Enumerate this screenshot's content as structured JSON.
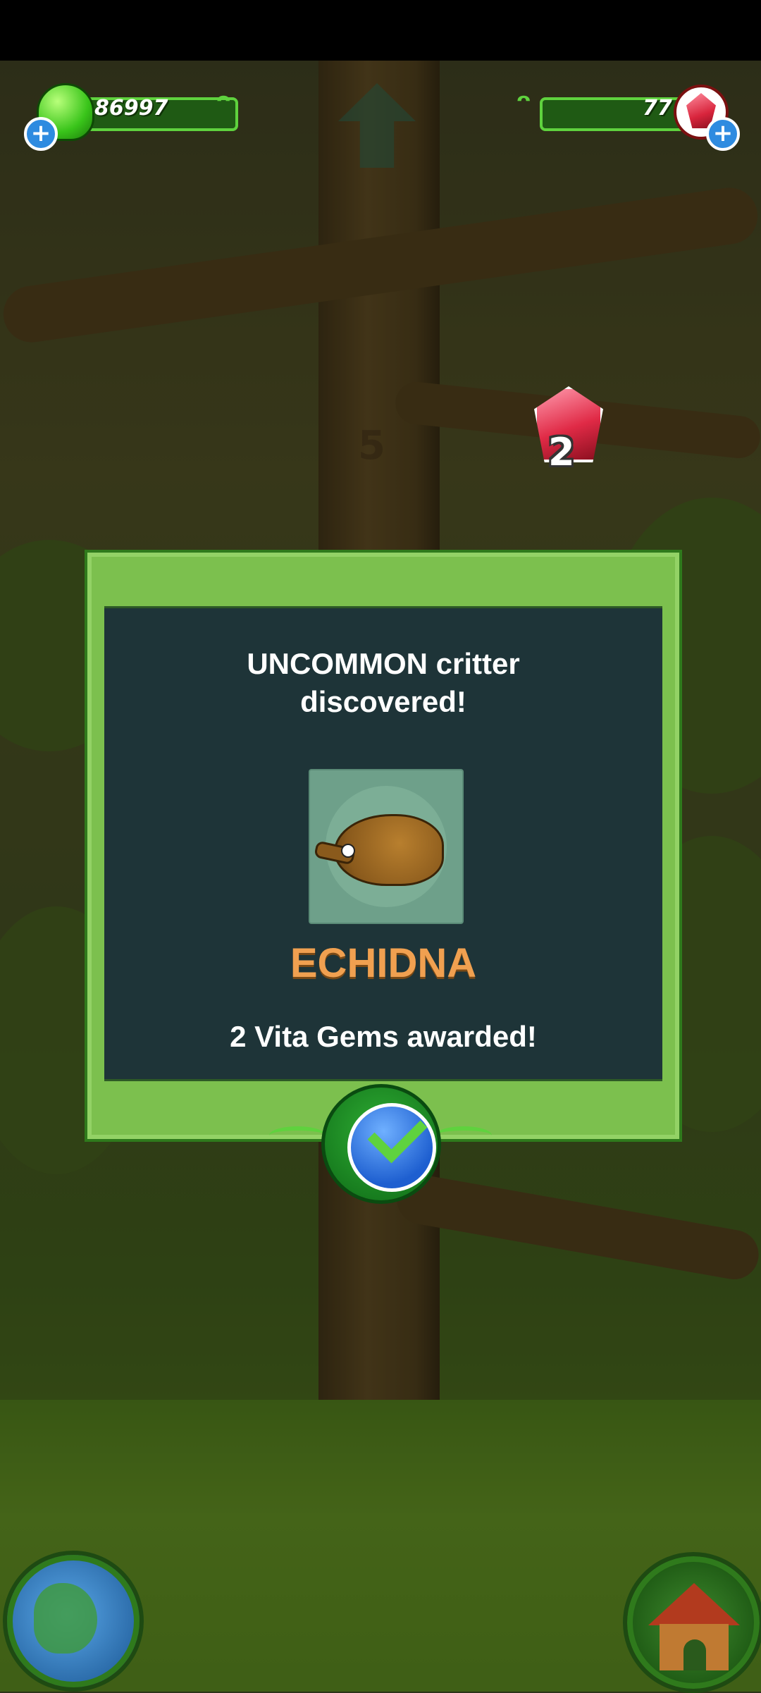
{
  "hud": {
    "jelly_count": "86997",
    "gem_count": "77",
    "add_jelly_label": "+",
    "add_gem_label": "+"
  },
  "scene": {
    "tree_floor_number": "5",
    "floating_reward_gems": "2"
  },
  "dialog": {
    "title": "UNCOMMON critter discovered!",
    "critter_name": "ECHIDNA",
    "reward_text": "2 Vita Gems awarded!"
  },
  "colors": {
    "dialog_frame": "#7cc04e",
    "dialog_panel": "#1e3438",
    "critter_name": "#f0a050",
    "hud_bar": "#1f5a14"
  },
  "icons": {
    "currency_left": "green-gumdrop-icon",
    "currency_right": "red-gem-icon",
    "confirm": "checkmark-icon",
    "bottom_left": "globe-icon",
    "bottom_right": "house-icon"
  }
}
